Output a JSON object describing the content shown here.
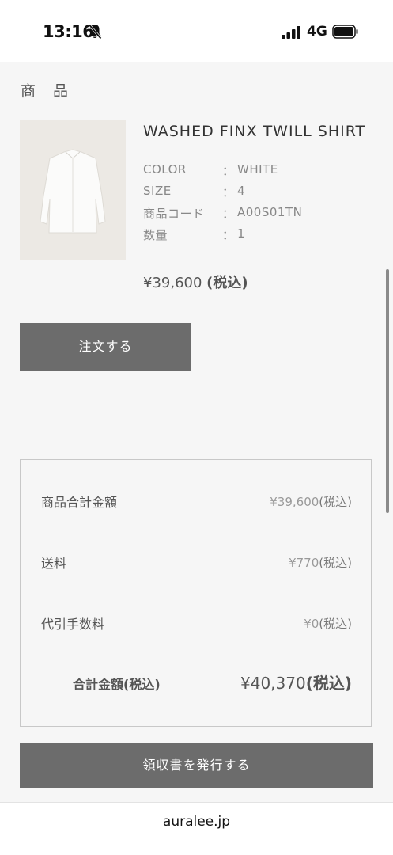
{
  "status_bar": {
    "time": "13:16",
    "network": "4G",
    "icons": [
      "bell-slash-icon",
      "signal-icon",
      "battery-icon"
    ]
  },
  "section": {
    "title": "商品"
  },
  "product": {
    "name": "WASHED FINX TWILL SHIRT",
    "image_icon": "shirt-icon",
    "attributes": [
      {
        "label": "COLOR",
        "separator": "：",
        "value": "WHITE"
      },
      {
        "label": "SIZE",
        "separator": "：",
        "value": "4"
      },
      {
        "label": "商品コード",
        "separator": "：",
        "value": "A00S01TN"
      },
      {
        "label": "数量",
        "separator": "：",
        "value": "1"
      }
    ],
    "price": "¥39,600 ",
    "price_tax": "(税込)"
  },
  "order_button": {
    "label": "注文する"
  },
  "summary": {
    "rows": [
      {
        "label": "商品合計金額",
        "value": "¥39,600",
        "tax": "(税込)"
      },
      {
        "label": "送料",
        "value": "¥770",
        "tax": "(税込)"
      },
      {
        "label": "代引手数料",
        "value": "¥0",
        "tax": "(税込)"
      }
    ],
    "total": {
      "label": "合計金額(税込)",
      "value": "¥40,370",
      "tax": "(税込)"
    }
  },
  "receipt_button": {
    "label": "領収書を発行する"
  },
  "browser": {
    "url": "auralee.jp"
  },
  "colors": {
    "button": "#6c6c6c",
    "background": "#f6f6f6",
    "divider": "#cfcfcf"
  }
}
